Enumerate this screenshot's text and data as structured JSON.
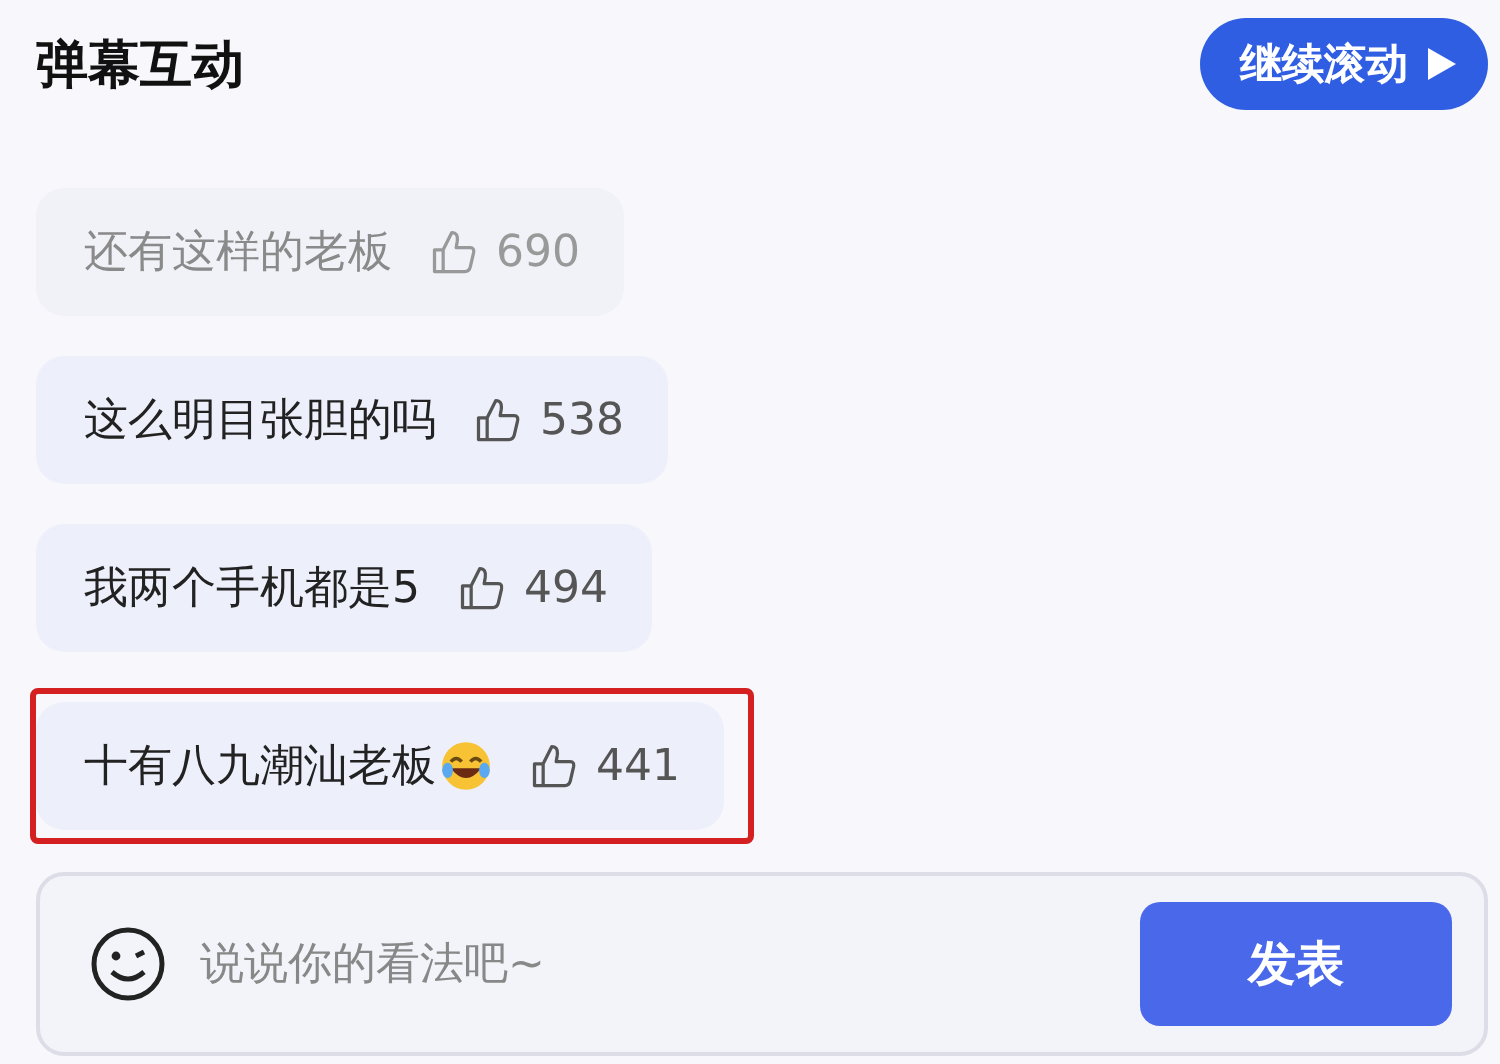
{
  "header": {
    "title": "弹幕互动",
    "button": "继续滚动"
  },
  "comments": [
    {
      "text": "还有这样的老板",
      "likes": "690",
      "faded": true,
      "emoji": false,
      "highlighted": false
    },
    {
      "text": "这么明目张胆的吗",
      "likes": "538",
      "faded": false,
      "emoji": false,
      "highlighted": false
    },
    {
      "text": "我两个手机都是5",
      "likes": "494",
      "faded": false,
      "emoji": false,
      "highlighted": false
    },
    {
      "text": "十有八九潮汕老板",
      "likes": "441",
      "faded": false,
      "emoji": true,
      "highlighted": true
    }
  ],
  "composer": {
    "placeholder": "说说你的看法吧~",
    "button": "发表"
  }
}
